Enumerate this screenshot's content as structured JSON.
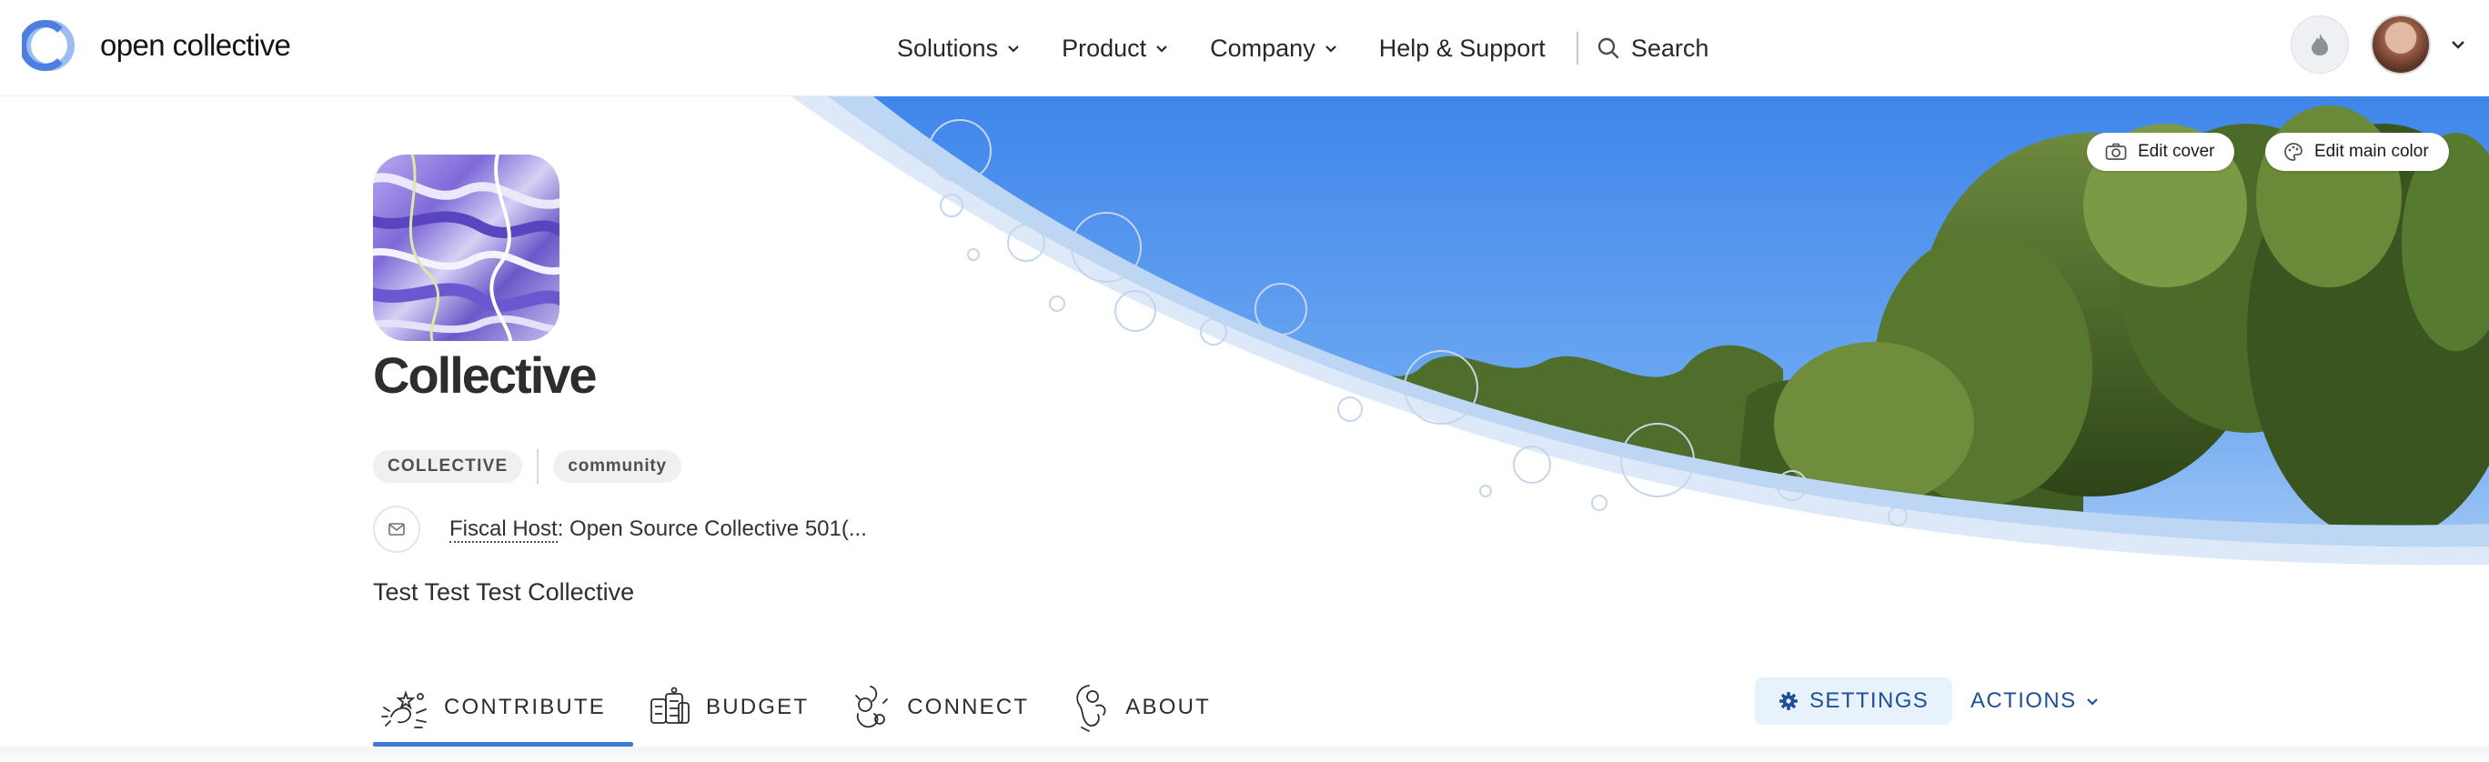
{
  "navbar": {
    "logo_text": "open collective",
    "menu": [
      {
        "label": "Solutions"
      },
      {
        "label": "Product"
      },
      {
        "label": "Company"
      }
    ],
    "help_label": "Help & Support",
    "search_label": "Search"
  },
  "cover": {
    "edit_cover_label": "Edit cover",
    "edit_color_label": "Edit main color"
  },
  "profile": {
    "name": "Collective",
    "tags": [
      "COLLECTIVE",
      "community"
    ],
    "fiscal_host_label": "Fiscal Host",
    "fiscal_host_value": ": Open Source Collective 501(...",
    "description": "Test Test Test Collective"
  },
  "tabs": [
    {
      "label": "CONTRIBUTE",
      "active": true
    },
    {
      "label": "BUDGET",
      "active": false
    },
    {
      "label": "CONNECT",
      "active": false
    },
    {
      "label": "ABOUT",
      "active": false
    }
  ],
  "actions": {
    "settings_label": "SETTINGS",
    "actions_label": "ACTIONS"
  },
  "colors": {
    "accent": "#3f78d4",
    "link_blue": "#1f4f97",
    "settings_bg": "#e8f2fd"
  }
}
